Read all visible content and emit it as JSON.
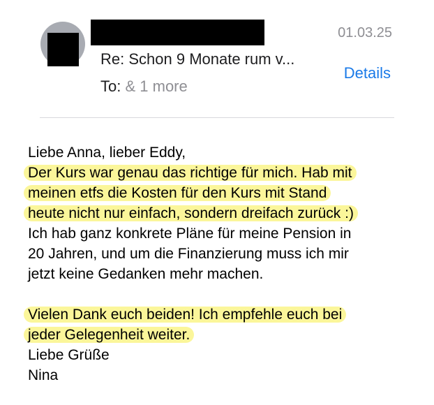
{
  "header": {
    "date": "01.03.25",
    "subject": "Re: Schon 9 Monate rum v...",
    "details_label": "Details",
    "to_label": "To:",
    "more_recipients": "& 1 more"
  },
  "message": {
    "greeting": "Liebe Anna, lieber Eddy,",
    "highlighted_1": [
      "Der Kurs war genau das richtige für mich. Hab mit",
      "meinen etfs die Kosten für den Kurs mit Stand",
      "heute nicht nur einfach, sondern dreifach zurück :)"
    ],
    "paragraph_1": [
      "Ich hab ganz konkrete Pläne für meine Pension in",
      "20 Jahren, und um die Finanzierung muss ich mir",
      "jetzt keine Gedanken mehr machen."
    ],
    "highlighted_2": [
      "Vielen Dank euch beiden! Ich empfehle euch bei",
      "jeder Gelegenheit weiter."
    ],
    "closing": "Liebe Grüße",
    "signature": "Nina"
  },
  "colors": {
    "highlight": "#fbf69a",
    "link": "#1a7ae8",
    "muted": "#8e8e93"
  }
}
